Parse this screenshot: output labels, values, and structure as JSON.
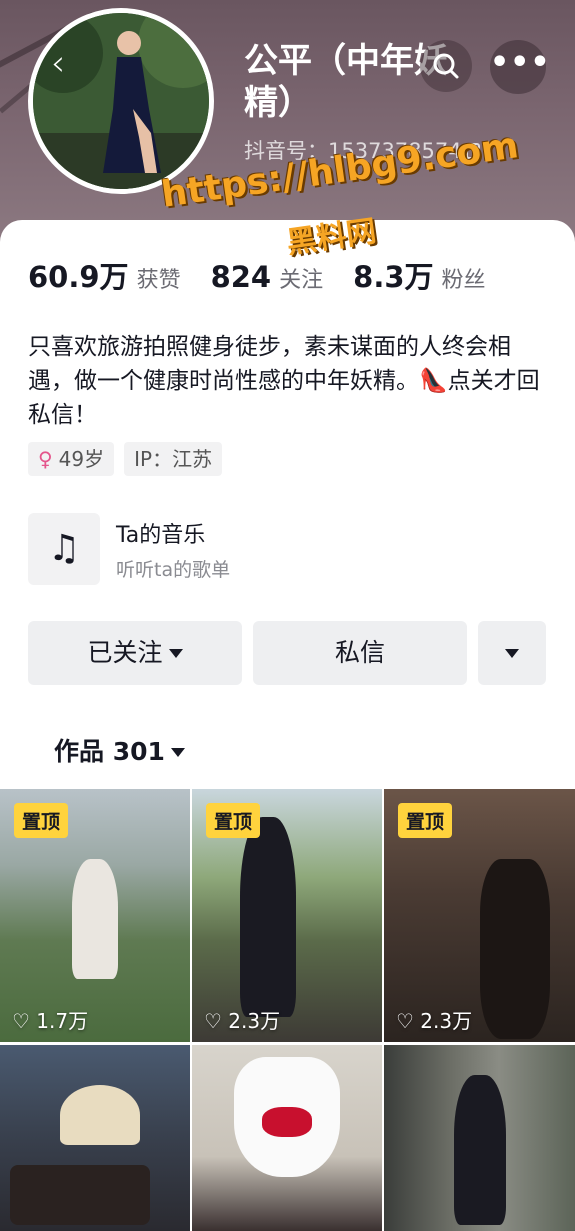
{
  "profile": {
    "name": "公平（中年妖精）",
    "id_label": "抖音号：1537378574",
    "back_icon": "chevron-left-icon",
    "search_icon": "search-icon",
    "more_icon": "more-dots-icon",
    "more_glyph": "•••"
  },
  "watermark": {
    "url": "https://hlbg9.com",
    "text": "黑料网"
  },
  "stats": [
    {
      "value": "60.9万",
      "label": "获赞"
    },
    {
      "value": "824",
      "label": "关注"
    },
    {
      "value": "8.3万",
      "label": "粉丝"
    }
  ],
  "bio": "只喜欢旅游拍照健身徒步，素未谋面的人终会相遇，做一个健康时尚性感的中年妖精。👠点关才回私信！",
  "tags": {
    "gender_icon": "female-icon",
    "gender_glyph": "♀",
    "age": "49岁",
    "ip": "IP：江苏"
  },
  "music": {
    "icon": "music-note-icon",
    "glyph": "♫",
    "title": "Ta的音乐",
    "subtitle": "听听ta的歌单"
  },
  "actions": {
    "follow_label": "已关注",
    "message_label": "私信"
  },
  "works_tab": {
    "label": "作品 301"
  },
  "videos": [
    {
      "pinned": "置顶",
      "likes": "♡ 1.7万"
    },
    {
      "pinned": "置顶",
      "likes": "♡ 2.3万"
    },
    {
      "pinned": "置顶",
      "likes": "♡ 2.3万"
    },
    {
      "pinned": "",
      "likes": ""
    },
    {
      "pinned": "",
      "likes": ""
    },
    {
      "pinned": "",
      "likes": ""
    }
  ],
  "colors": {
    "pin_badge": "#ffd33d",
    "header_bg": "#7b6670",
    "watermark": "#f6a524"
  }
}
